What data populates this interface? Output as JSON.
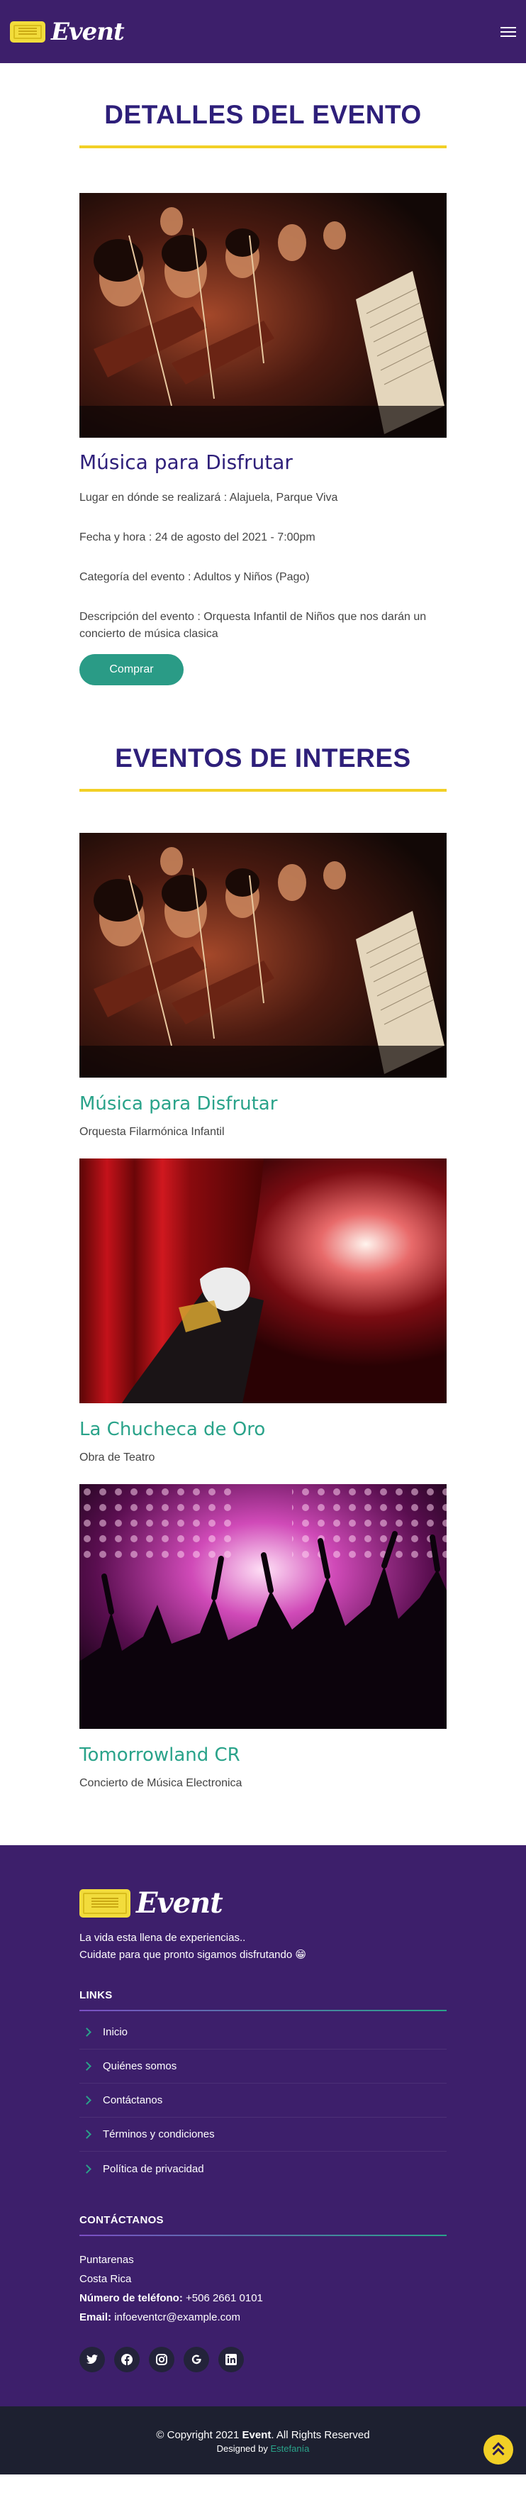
{
  "header": {
    "logo_text": "Event"
  },
  "details": {
    "section_title": "DETALLES DEL EVENTO",
    "event_name": "Música para Disfrutar",
    "location": "Lugar en dónde se realizará : Alajuela, Parque Viva",
    "datetime": "Fecha y hora : 24 de agosto del 2021 - 7:00pm",
    "category": "Categoría del evento : Adultos y Niños (Pago)",
    "description": "Descripción del evento : Orquesta Infantil de Niños que nos darán un concierto de música clasica",
    "buy_label": "Comprar"
  },
  "interest": {
    "section_title": "EVENTOS DE INTERES",
    "cards": [
      {
        "title": "Música para Disfrutar",
        "subtitle": "Orquesta Filarmónica Infantil"
      },
      {
        "title": "La Chucheca de Oro",
        "subtitle": "Obra de Teatro"
      },
      {
        "title": "Tomorrowland CR",
        "subtitle": "Concierto de Música Electronica"
      }
    ]
  },
  "footer": {
    "logo_text": "Event",
    "tagline_1": "La vida esta llena de experiencias..",
    "tagline_2": "Cuidate para que pronto sigamos disfrutando 😁",
    "links_heading": "LINKS",
    "links": [
      "Inicio",
      "Quiénes somos",
      "Contáctanos",
      "Términos y condiciones",
      "Política de privacidad"
    ],
    "contact_heading": "CONTÁCTANOS",
    "city": "Puntarenas",
    "country": "Costa Rica",
    "phone_label": "Número de teléfono:",
    "phone": "+506 2661 0101",
    "email_label": "Email:",
    "email": "infoeventcr@example.com",
    "social_icons": [
      "twitter-icon",
      "facebook-icon",
      "instagram-icon",
      "google-icon",
      "linkedin-icon"
    ]
  },
  "bottom": {
    "copyright_pre": "© Copyright 2021 ",
    "copyright_brand": "Event",
    "copyright_post": ". All Rights Reserved",
    "designed_by": "Designed by ",
    "designer": "Estefanía"
  },
  "colors": {
    "header_bg": "#3d1f6b",
    "title_color": "#2e1f7a",
    "accent_yellow": "#f2d026",
    "accent_green": "#2aa38a"
  }
}
